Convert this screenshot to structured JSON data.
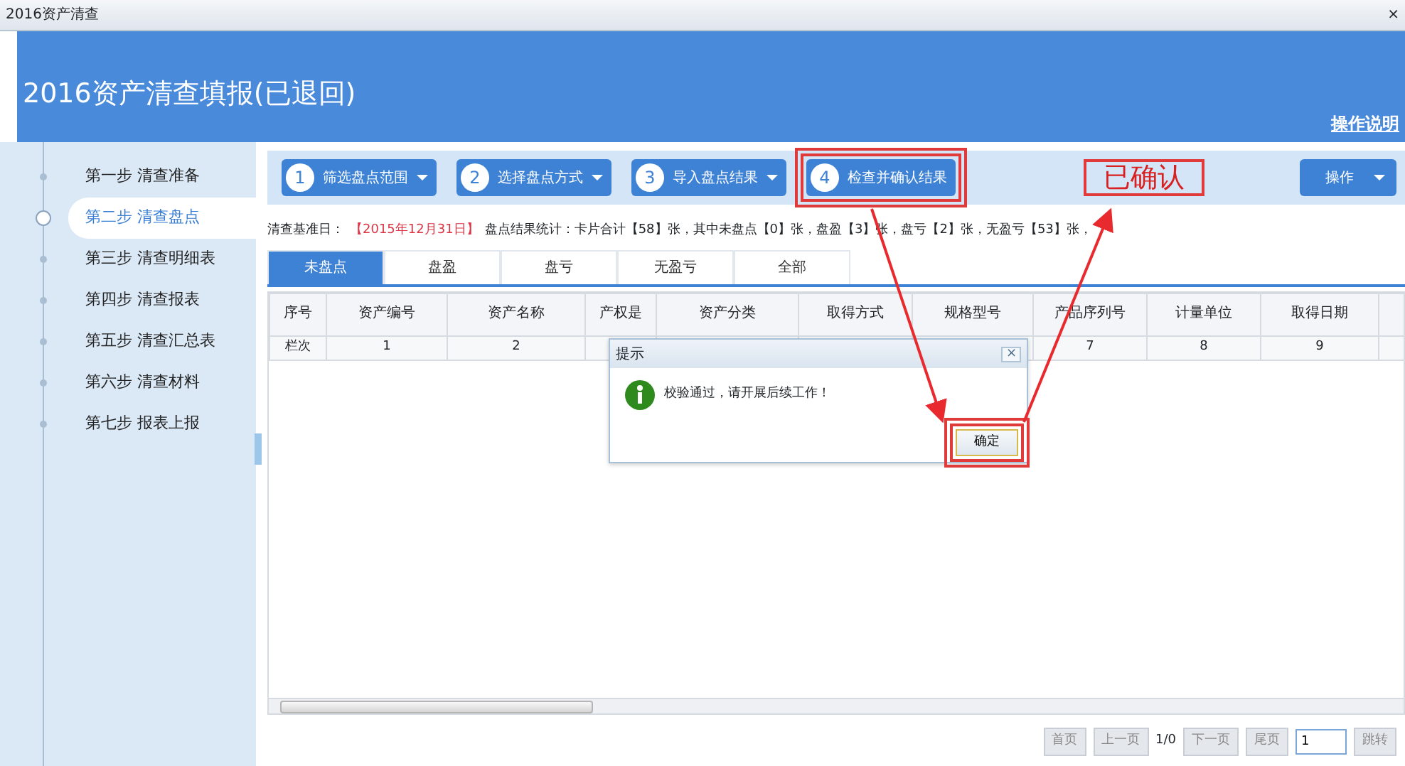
{
  "window": {
    "title": "2016资产清查",
    "close": "×"
  },
  "header": {
    "title": "2016资产清查填报(已退回)",
    "help_link": "操作说明"
  },
  "sidebar": {
    "items": [
      {
        "label": "第一步 清查准备",
        "selected": false
      },
      {
        "label": "第二步 清查盘点",
        "selected": true
      },
      {
        "label": "第三步 清查明细表",
        "selected": false
      },
      {
        "label": "第四步 清查报表",
        "selected": false
      },
      {
        "label": "第五步 清查汇总表",
        "selected": false
      },
      {
        "label": "第六步 清查材料",
        "selected": false
      },
      {
        "label": "第七步 报表上报",
        "selected": false
      }
    ]
  },
  "steps": [
    {
      "number": "1",
      "label": "筛选盘点范围",
      "dropdown": true,
      "highlighted": false
    },
    {
      "number": "2",
      "label": "选择盘点方式",
      "dropdown": true,
      "highlighted": false
    },
    {
      "number": "3",
      "label": "导入盘点结果",
      "dropdown": true,
      "highlighted": false
    },
    {
      "number": "4",
      "label": "检查并确认结果",
      "dropdown": false,
      "highlighted": true
    }
  ],
  "status_label": "已确认",
  "actions_button": "操作",
  "info": {
    "label": "清查基准日：",
    "date": "【2015年12月31日】",
    "stats": "盘点结果统计：卡片合计【58】张，其中未盘点【0】张，盘盈【3】张，盘亏【2】张，无盈亏【53】张，"
  },
  "tabs": [
    {
      "label": "未盘点",
      "selected": true
    },
    {
      "label": "盘盈",
      "selected": false
    },
    {
      "label": "盘亏",
      "selected": false
    },
    {
      "label": "无盈亏",
      "selected": false
    },
    {
      "label": "全部",
      "selected": false
    }
  ],
  "table": {
    "columns": [
      "序号",
      "资产编号",
      "资产名称",
      "产权是",
      "资产分类",
      "取得方式",
      "规格型号",
      "产品序列号",
      "计量单位",
      "取得日期"
    ],
    "rows": [
      [
        "栏次",
        "1",
        "2",
        "",
        "",
        "",
        "",
        "7",
        "8",
        "9"
      ]
    ]
  },
  "dialog": {
    "title": "提示",
    "close": "×",
    "message": "校验通过，请开展后续工作！",
    "ok_button": "确定",
    "ok_highlighted": true
  },
  "pagination": {
    "first": "首页",
    "prev": "上一页",
    "page": "1/0",
    "next": "下一页",
    "last": "尾页",
    "page_input": "1",
    "go": "跳转"
  }
}
